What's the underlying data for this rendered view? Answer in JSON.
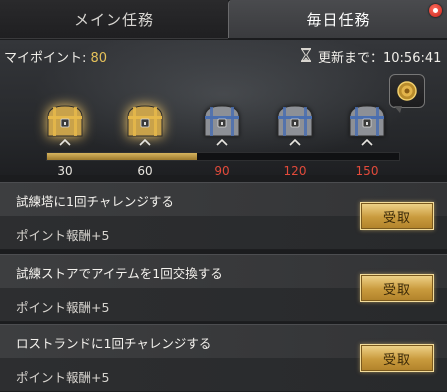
{
  "tabs": [
    {
      "label": "メイン任務"
    },
    {
      "label": "毎日任務"
    }
  ],
  "points": {
    "label": "マイポイント:",
    "value": "80"
  },
  "timer": {
    "label": "更新まで：10:56:41"
  },
  "chests": [
    {
      "points": "30",
      "state": "unlocked",
      "color": "#e6b84a"
    },
    {
      "points": "60",
      "state": "unlocked",
      "color": "#e6b84a"
    },
    {
      "points": "90",
      "state": "locked",
      "color": "#4a6fb0"
    },
    {
      "points": "120",
      "state": "locked",
      "color": "#4a6fb0"
    },
    {
      "points": "150",
      "state": "locked",
      "color": "#4a6fb0"
    }
  ],
  "progress": {
    "current": 80,
    "max": 150
  },
  "missions": [
    {
      "title": "試練塔に1回チャレンジする",
      "reward": "ポイント報酬+5",
      "button": "受取"
    },
    {
      "title": "試練ストアでアイテムを1回交換する",
      "reward": "ポイント報酬+5",
      "button": "受取"
    },
    {
      "title": "ロストランドに1回チャレンジする",
      "reward": "ポイント報酬+5",
      "button": "受取"
    }
  ],
  "colors": {
    "accent_gold": "#e6c25a",
    "locked_red": "#e24a3a",
    "notification": "#c9231a"
  },
  "icons": {
    "timer": "hourglass-icon",
    "gift": "gift-box-icon",
    "chest": "treasure-chest-icon",
    "marker": "chevron-up-icon"
  }
}
